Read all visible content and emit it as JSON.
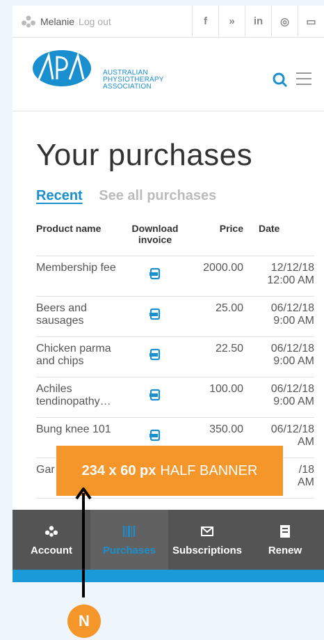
{
  "topbar": {
    "user_name": "Melanie",
    "logout_label": "Log out",
    "social": [
      "f",
      "»",
      "in",
      "◎",
      "▭"
    ]
  },
  "header": {
    "logo_lines": [
      "AUSTRALIAN",
      "PHYSIOTHERAPY",
      "ASSOCIATION"
    ]
  },
  "page": {
    "title": "Your purchases",
    "tabs": {
      "recent": "Recent",
      "all": "See all purchases"
    }
  },
  "table": {
    "headers": {
      "name": "Product name",
      "invoice": "Download invoice",
      "price": "Price",
      "date": "Date"
    },
    "rows": [
      {
        "name": "Membership fee",
        "price": "2000.00",
        "date": "12/12/18",
        "time": "12:00 AM"
      },
      {
        "name": "Beers and sausages",
        "price": "25.00",
        "date": "06/12/18",
        "time": "9:00 AM"
      },
      {
        "name": "Chicken parma and chips",
        "price": "22.50",
        "date": "06/12/18",
        "time": "9:00 AM"
      },
      {
        "name": "Achiles tendinopathy…",
        "price": "100.00",
        "date": "06/12/18",
        "time": "9:00 AM"
      },
      {
        "name": "Bung knee 101",
        "price": "350.00",
        "date": "06/12/18",
        "time": "AM"
      },
      {
        "name": "Gar mas",
        "price": "",
        "date": "/18",
        "time": "AM"
      }
    ]
  },
  "nav": {
    "account": "Account",
    "purchases": "Purchases",
    "subscriptions": "Subscriptions",
    "renew": "Renew"
  },
  "banner": {
    "size": "234 x 60 px",
    "label": "HALF BANNER"
  },
  "marker": {
    "label": "N"
  },
  "colors": {
    "brand_blue": "#1a8fcf",
    "banner_orange": "#f5962a",
    "nav_grey": "#545454"
  }
}
